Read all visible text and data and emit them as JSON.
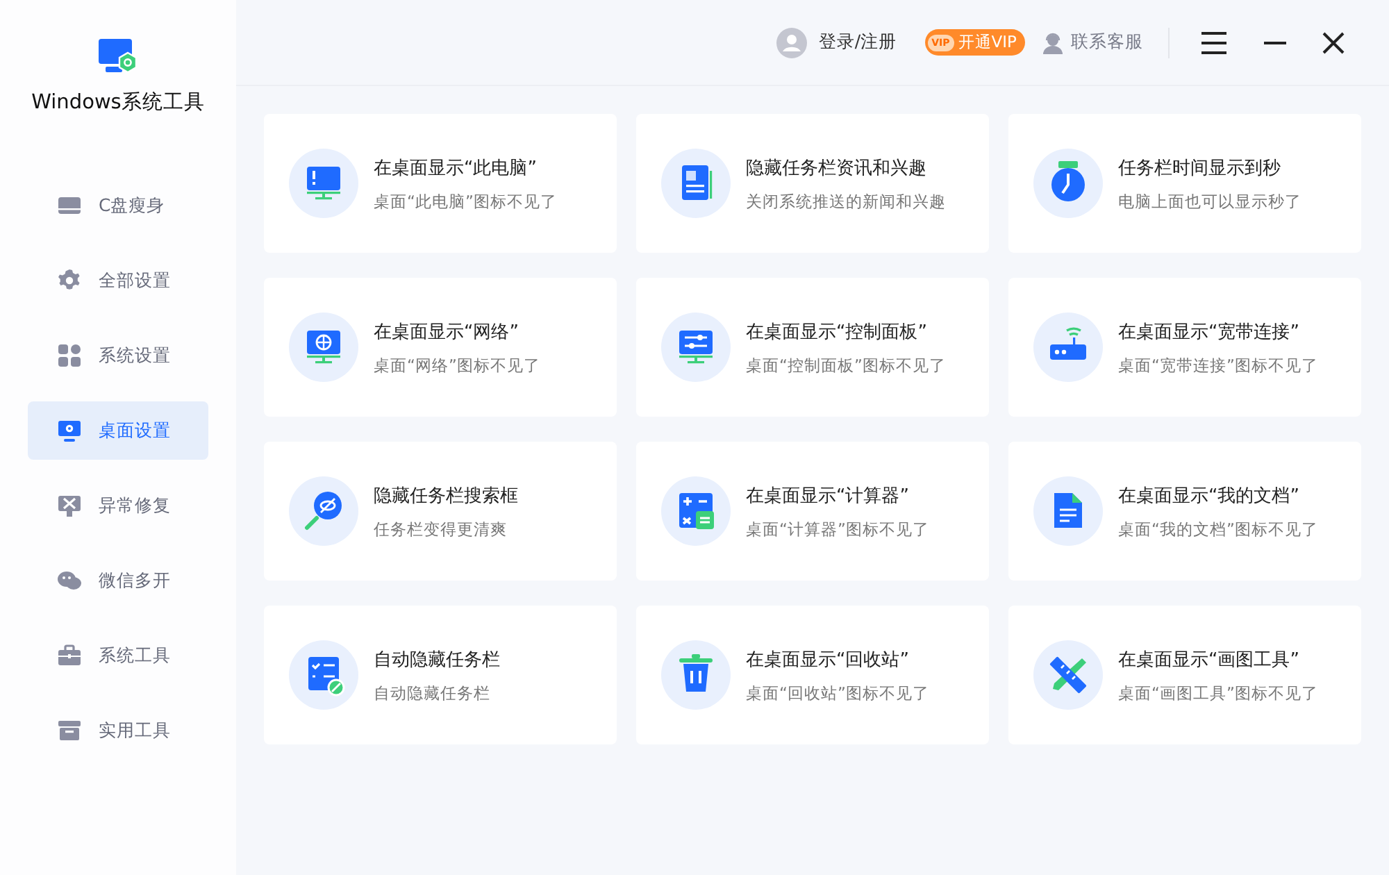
{
  "app": {
    "title": "Windows系统工具"
  },
  "sidebar": {
    "items": [
      {
        "label": "C盘瘦身",
        "selected": false
      },
      {
        "label": "全部设置",
        "selected": false
      },
      {
        "label": "系统设置",
        "selected": false
      },
      {
        "label": "桌面设置",
        "selected": true
      },
      {
        "label": "异常修复",
        "selected": false
      },
      {
        "label": "微信多开",
        "selected": false
      },
      {
        "label": "系统工具",
        "selected": false
      },
      {
        "label": "实用工具",
        "selected": false
      }
    ]
  },
  "header": {
    "login": "登录/注册",
    "vip_mark": "VIP",
    "vip_button": "开通VIP",
    "contact": "联系客服"
  },
  "cards": [
    {
      "title": "在桌面显示“此电脑”",
      "subtitle": "桌面“此电脑”图标不见了"
    },
    {
      "title": "隐藏任务栏资讯和兴趣",
      "subtitle": "关闭系统推送的新闻和兴趣"
    },
    {
      "title": "任务栏时间显示到秒",
      "subtitle": "电脑上面也可以显示秒了"
    },
    {
      "title": "在桌面显示“网络”",
      "subtitle": "桌面“网络”图标不见了"
    },
    {
      "title": "在桌面显示“控制面板”",
      "subtitle": "桌面“控制面板”图标不见了"
    },
    {
      "title": "在桌面显示“宽带连接”",
      "subtitle": "桌面“宽带连接”图标不见了"
    },
    {
      "title": "隐藏任务栏搜索框",
      "subtitle": "任务栏变得更清爽"
    },
    {
      "title": "在桌面显示“计算器”",
      "subtitle": "桌面“计算器”图标不见了"
    },
    {
      "title": "在桌面显示“我的文档”",
      "subtitle": "桌面“我的文档”图标不见了"
    },
    {
      "title": "自动隐藏任务栏",
      "subtitle": "自动隐藏任务栏"
    },
    {
      "title": "在桌面显示“回收站”",
      "subtitle": "桌面“回收站”图标不见了"
    },
    {
      "title": "在桌面显示“画图工具”",
      "subtitle": "桌面“画图工具”图标不见了"
    }
  ]
}
